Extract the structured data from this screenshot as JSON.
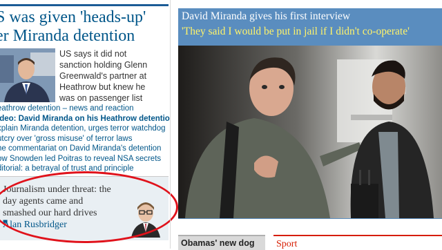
{
  "left_column": {
    "headline_lines": [
      "S was given 'heads-up'",
      "er Miranda detention"
    ],
    "summary_lines": [
      "US says it did not",
      "sanction holding Glenn",
      "Greenwald's partner at",
      "Heathrow but knew he",
      "was on passenger list"
    ],
    "links": [
      {
        "text": "eathrow detention – news and reaction",
        "bold": false
      },
      {
        "text": "ideo: David Miranda on his Heathrow detention",
        "bold": true
      },
      {
        "text": "xplain Miranda detention, urges terror watchdog",
        "bold": false
      },
      {
        "text": "utcry over 'gross misuse' of terror laws",
        "bold": false
      },
      {
        "text": "he commentariat on David Miranda's detention",
        "bold": false
      },
      {
        "text": "ow Snowden led Poitras to reveal NSA secrets",
        "bold": false
      },
      {
        "text": "ditorial: a betrayal of trust and principle",
        "bold": false
      }
    ]
  },
  "comment": {
    "headline_lines": [
      "Journalism under threat: the",
      "day agents came and",
      "smashed our hard drives"
    ],
    "quote_glyph": "❞",
    "author": "Alan Rusbridger"
  },
  "feature": {
    "title": "David Miranda gives his first interview",
    "subtitle": "'They said I would be put in jail if I didn't co-operate'"
  },
  "bottom": {
    "left_label": "Obamas' new dog",
    "right_label": "Sport"
  },
  "colors": {
    "link": "#005689",
    "panel": "#5a8dbf",
    "subtitle": "#fff36a",
    "highlight_oval": "#e0121b",
    "sport": "#d61d00"
  }
}
